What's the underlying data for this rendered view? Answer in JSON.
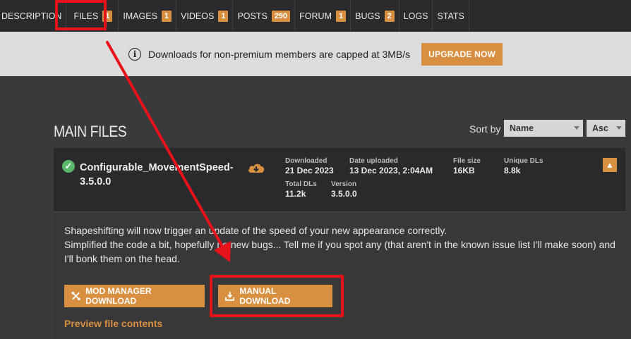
{
  "tabs": [
    {
      "label": "DESCRIPTION",
      "badge": ""
    },
    {
      "label": "FILES",
      "badge": "1"
    },
    {
      "label": "IMAGES",
      "badge": "1"
    },
    {
      "label": "VIDEOS",
      "badge": "1"
    },
    {
      "label": "POSTS",
      "badge": "290"
    },
    {
      "label": "FORUM",
      "badge": "1"
    },
    {
      "label": "BUGS",
      "badge": "2"
    },
    {
      "label": "LOGS",
      "badge": ""
    },
    {
      "label": "STATS",
      "badge": ""
    }
  ],
  "banner": {
    "info_icon": "i",
    "text": "Downloads for non-premium members are capped at 3MB/s",
    "upgrade_label": "UPGRADE NOW"
  },
  "section": {
    "title": "MAIN FILES",
    "sort_label": "Sort by",
    "sort_field": "Name",
    "sort_order": "Asc"
  },
  "file": {
    "name": "Configurable_MovementSpeed-3.5.0.0",
    "meta": {
      "downloaded_label": "Downloaded",
      "downloaded_value": "21 Dec 2023",
      "uploaded_label": "Date uploaded",
      "uploaded_value": "13 Dec 2023, 2:04AM",
      "size_label": "File size",
      "size_value": "16KB",
      "unique_label": "Unique DLs",
      "unique_value": "8.8k",
      "total_label": "Total DLs",
      "total_value": "11.2k",
      "version_label": "Version",
      "version_value": "3.5.0.0"
    },
    "description": [
      "Shapeshifting will now trigger an update of the speed of your new appearance correctly.",
      "Simplified the code a bit, hopefully no new bugs... Tell me if you spot any (that aren't in the known issue list I'll make soon) and I'll bonk them on the head."
    ],
    "mod_manager_label": "MOD MANAGER DOWNLOAD",
    "manual_label": "MANUAL DOWNLOAD",
    "preview_label": "Preview file contents"
  },
  "colors": {
    "accent": "#d98f40",
    "annotation": "#e8121a",
    "check": "#5bb86b"
  },
  "icons": [
    "info-icon",
    "check-icon",
    "cloud-download-icon",
    "chevron-up-icon",
    "mod-manager-icon",
    "download-icon",
    "chevron-down-icon"
  ]
}
